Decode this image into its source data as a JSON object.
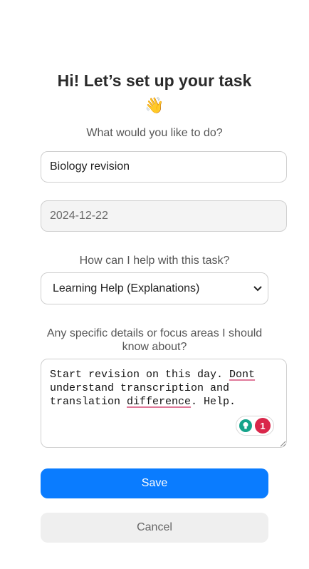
{
  "heading": {
    "title": "Hi! Let’s set up your task",
    "emoji": "👋"
  },
  "task": {
    "prompt": "What would you like to do?",
    "name_value": "Biology revision",
    "date_value": "2024-12-22"
  },
  "help": {
    "prompt": "How can I help with this task?",
    "selected": "Learning Help (Explanations)"
  },
  "details": {
    "prompt": "Any specific details or focus areas I should know about?",
    "text_part1": "Start revision on this day. ",
    "text_flag1": "Dont",
    "text_part2": " understand transcription and translation ",
    "text_flag2": "difference",
    "text_part3": ". Help."
  },
  "grammar_widget": {
    "count": "1"
  },
  "buttons": {
    "save": "Save",
    "cancel": "Cancel"
  },
  "colors": {
    "primary": "#0a7cff",
    "secondary": "#efefef",
    "alert": "#d9274a",
    "bulb": "#15a38a"
  }
}
